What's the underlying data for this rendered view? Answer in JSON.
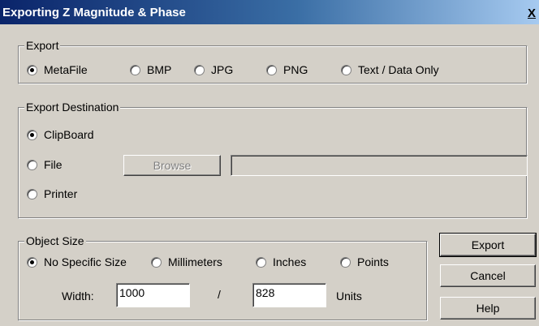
{
  "window": {
    "title": "Exporting Z Magnitude & Phase",
    "close_label": "X"
  },
  "export_group": {
    "legend": "Export",
    "options": [
      {
        "label": "MetaFile",
        "selected": true
      },
      {
        "label": "BMP",
        "selected": false
      },
      {
        "label": "JPG",
        "selected": false
      },
      {
        "label": "PNG",
        "selected": false
      },
      {
        "label": "Text / Data Only",
        "selected": false
      }
    ]
  },
  "destination_group": {
    "legend": "Export Destination",
    "options": [
      {
        "label": "ClipBoard",
        "selected": true
      },
      {
        "label": "File",
        "selected": false
      },
      {
        "label": "Printer",
        "selected": false
      }
    ],
    "browse_label": "Browse",
    "file_path": ""
  },
  "size_group": {
    "legend": "Object Size",
    "options": [
      {
        "label": "No Specific Size",
        "selected": true
      },
      {
        "label": "Millimeters",
        "selected": false
      },
      {
        "label": "Inches",
        "selected": false
      },
      {
        "label": "Points",
        "selected": false
      }
    ],
    "width_label": "Width:",
    "width_value": "1000",
    "separator": "/",
    "height_value": "828",
    "units_label": "Units"
  },
  "buttons": {
    "export": "Export",
    "cancel": "Cancel",
    "help": "Help"
  }
}
